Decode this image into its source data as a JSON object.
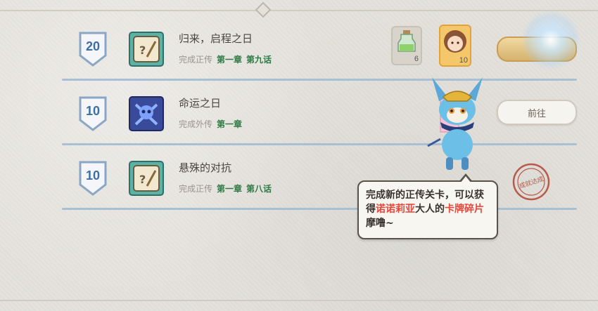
{
  "quests": [
    {
      "points": "20",
      "title": "归来，启程之日",
      "status": "完成正传",
      "chapter": "第一章",
      "episode": "第九话",
      "icon": "dice-sword-icon"
    },
    {
      "points": "10",
      "title": "命运之日",
      "status": "完成外传",
      "chapter": "第一章",
      "episode": "",
      "icon": "skull-crossbones-icon"
    },
    {
      "points": "10",
      "title": "悬殊的对抗",
      "status": "完成正传",
      "chapter": "第一章",
      "episode": "第八话",
      "icon": "dice-sword-icon"
    }
  ],
  "rewards": {
    "potion_count": "6",
    "portrait_count": "10",
    "hidden_count": "0"
  },
  "buttons": {
    "goto_label": "前往",
    "claim_label": ""
  },
  "stamp_label": "成就达成",
  "bubble": {
    "part1": "完成新的正传关卡，可以获得",
    "highlight1": "诺诺莉亚",
    "part2": "大人的",
    "highlight2": "卡牌碎片",
    "part3": "摩噜~"
  },
  "colors": {
    "badge_blue": "#3d6ea5",
    "chapter_green": "#2f7a44",
    "highlight_red": "#e34a3d",
    "divider": "#a9bfd3"
  }
}
